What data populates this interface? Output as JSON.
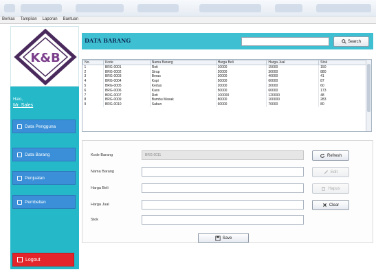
{
  "menubar": [
    "Berkas",
    "Tampilan",
    "Laporan",
    "Bantuan"
  ],
  "sidebar": {
    "logo_text": "K&B",
    "user_label": "Halo,",
    "user_name": "Mr. Sales",
    "items": [
      {
        "label": "Data Pengguna",
        "icon": "user-icon"
      },
      {
        "label": "Data Barang",
        "icon": "box-icon"
      },
      {
        "label": "Penjualan",
        "icon": "cart-icon"
      },
      {
        "label": "Pembelian",
        "icon": "grid-icon"
      }
    ],
    "logout_label": "Logout"
  },
  "header": {
    "title": "DATA BARANG",
    "search_value": "",
    "search_button": "Search"
  },
  "table": {
    "columns": [
      "No.",
      "Kode",
      "Nama Barang",
      "Harga Beli",
      "Harga Jual",
      "Stok"
    ],
    "rows": [
      [
        "1",
        "BRG-0001",
        "Roti",
        "10000",
        "15000",
        "150"
      ],
      [
        "2",
        "BRG-0002",
        "Sirup",
        "20000",
        "30000",
        "880"
      ],
      [
        "3",
        "BRG-0003",
        "Beras",
        "30000",
        "40000",
        "41"
      ],
      [
        "4",
        "BRG-0004",
        "Kopi",
        "50000",
        "60000",
        "87"
      ],
      [
        "5",
        "BRG-0005",
        "Kertas",
        "20000",
        "30000",
        "60"
      ],
      [
        "6",
        "BRG-0006",
        "Kaos",
        "50000",
        "60000",
        "173"
      ],
      [
        "7",
        "BRG-0007",
        "Roti",
        "100000",
        "120000",
        "48"
      ],
      [
        "8",
        "BRG-0009",
        "Bumbu Masak",
        "80000",
        "100000",
        "283"
      ],
      [
        "9",
        "BRG-0010",
        "Sabun",
        "60000",
        "70000",
        "80"
      ]
    ]
  },
  "form": {
    "fields": [
      {
        "label": "Kode Barang",
        "value": "BRG-0011",
        "disabled": true
      },
      {
        "label": "Nama Barang",
        "value": "",
        "disabled": false
      },
      {
        "label": "Harga Beli",
        "value": "",
        "disabled": false
      },
      {
        "label": "Harga Jual",
        "value": "",
        "disabled": false
      },
      {
        "label": "Stok",
        "value": "",
        "disabled": false
      }
    ],
    "buttons": {
      "refresh": "Refresh",
      "edit": "Edit",
      "delete": "Hapus",
      "clear": "Clear",
      "save": "Save"
    }
  },
  "colors": {
    "sidebar": "#25b8c9",
    "header": "#3fc0d2",
    "nav_button": "#3a8fd8",
    "logout": "#e3252b"
  }
}
